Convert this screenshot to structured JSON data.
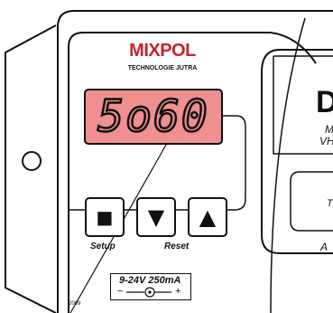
{
  "brand": {
    "name": "MIXPOL",
    "tagline": "TECHNOLOGIE JUTRA",
    "accent_color": "#c8232c"
  },
  "display": {
    "value": "5o60",
    "background_color": "#ef8f8f"
  },
  "keys": [
    {
      "icon": "stop-square-icon",
      "glyph": "■"
    },
    {
      "icon": "arrow-down-icon",
      "glyph": "▼"
    },
    {
      "icon": "arrow-up-icon",
      "glyph": "▲"
    }
  ],
  "key_labels": {
    "setup": "Setup",
    "reset": "Reset"
  },
  "power": {
    "spec": "9-24V  250mA",
    "minus": "−",
    "plus": "+",
    "icon": "polarity-plug-icon"
  },
  "year": "2009",
  "right_panel": {
    "big_letter": "D",
    "line_a": "Mik",
    "line_b": "VHF",
    "line_c": "T",
    "line_d": "A"
  }
}
